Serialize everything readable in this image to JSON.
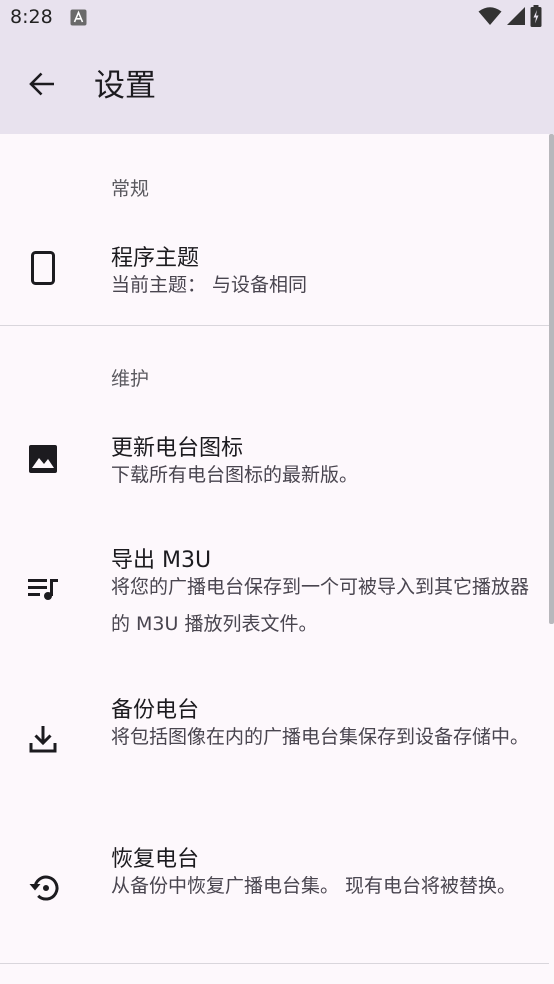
{
  "status_bar": {
    "time": "8:28"
  },
  "header": {
    "title": "设置"
  },
  "sections": [
    {
      "header": "常规",
      "items": [
        {
          "icon": "smartphone-icon",
          "title": "程序主题",
          "summary": "当前主题： 与设备相同"
        }
      ]
    },
    {
      "header": "维护",
      "items": [
        {
          "icon": "image-icon",
          "title": "更新电台图标",
          "summary": "下载所有电台图标的最新版。"
        },
        {
          "icon": "queue-music-icon",
          "title": "导出 M3U",
          "summary": "将您的广播电台保存到一个可被导入到其它播放器的 M3U 播放列表文件。"
        },
        {
          "icon": "download-icon",
          "title": "备份电台",
          "summary": "将包括图像在内的广播电台集保存到设备存储中。"
        },
        {
          "icon": "restore-icon",
          "title": "恢复电台",
          "summary": "从备份中恢复广播电台集。 现有电台将被替换。"
        }
      ]
    }
  ],
  "colors": {
    "app_bar_background": "#e8e2ee",
    "page_background": "#fdf8fc",
    "primary_text": "#1c1b1f",
    "secondary_text": "#49454f",
    "divider": "#d9d6dc"
  }
}
